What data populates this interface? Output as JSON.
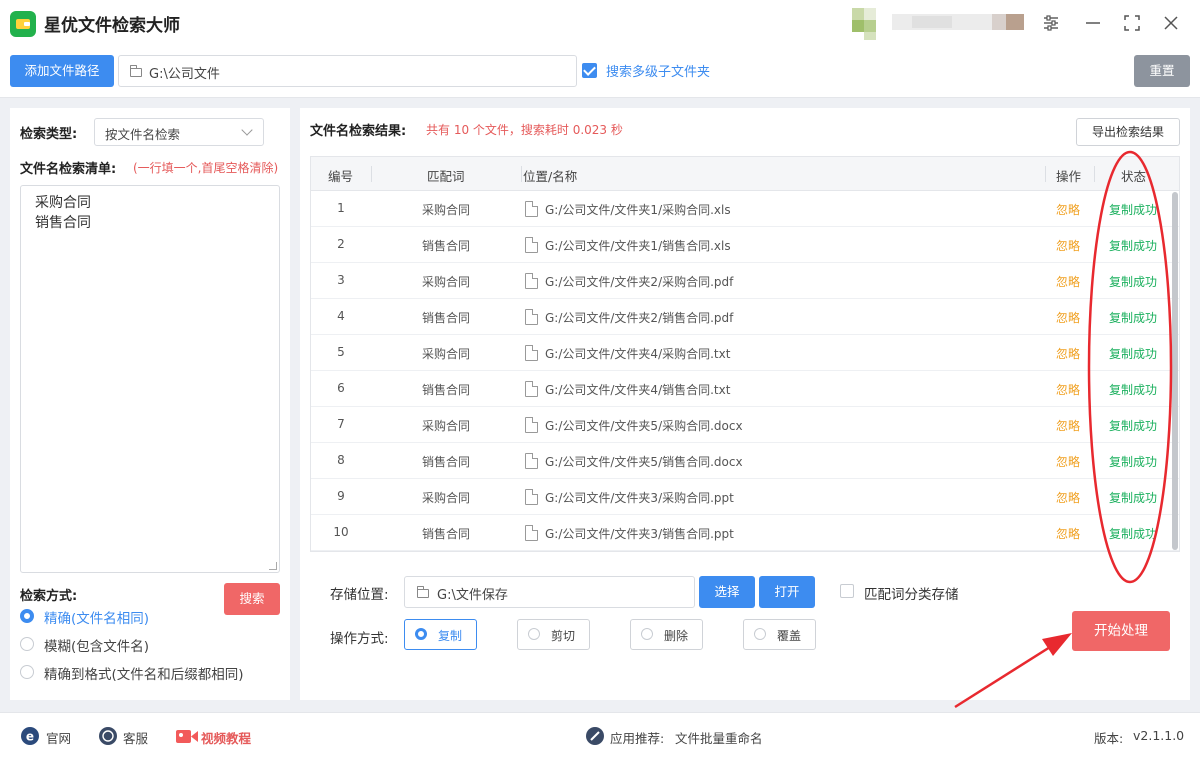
{
  "app": {
    "title": "星优文件检索大师"
  },
  "toolbar": {
    "add_path_label": "添加文件路径",
    "path_value": "G:\\公司文件",
    "subfolder_checkbox_label": "搜索多级子文件夹",
    "subfolder_checked": true,
    "reset_label": "重置"
  },
  "left": {
    "search_type_label": "检索类型:",
    "search_type_value": "按文件名检索",
    "list_label": "文件名检索清单:",
    "list_hint": "(一行填一个,首尾空格清除)",
    "keywords": [
      "采购合同",
      "销售合同"
    ],
    "search_button": "搜索",
    "method_label": "检索方式:",
    "methods": [
      {
        "label": "精确(文件名相同)",
        "selected": true
      },
      {
        "label": "模糊(包含文件名)",
        "selected": false
      },
      {
        "label": "精确到格式(文件名和后缀都相同)",
        "selected": false
      }
    ]
  },
  "results": {
    "title": "文件名检索结果:",
    "summary": "共有 10 个文件，搜索耗时 0.023 秒",
    "export_label": "导出检索结果",
    "columns": {
      "num": "编号",
      "keyword": "匹配词",
      "path": "位置/名称",
      "op": "操作",
      "status": "状态"
    },
    "rows": [
      {
        "num": "1",
        "keyword": "采购合同",
        "path": "G:/公司文件/文件夹1/采购合同.xls",
        "op": "忽略",
        "status": "复制成功"
      },
      {
        "num": "2",
        "keyword": "销售合同",
        "path": "G:/公司文件/文件夹1/销售合同.xls",
        "op": "忽略",
        "status": "复制成功"
      },
      {
        "num": "3",
        "keyword": "采购合同",
        "path": "G:/公司文件/文件夹2/采购合同.pdf",
        "op": "忽略",
        "status": "复制成功"
      },
      {
        "num": "4",
        "keyword": "销售合同",
        "path": "G:/公司文件/文件夹2/销售合同.pdf",
        "op": "忽略",
        "status": "复制成功"
      },
      {
        "num": "5",
        "keyword": "采购合同",
        "path": "G:/公司文件/文件夹4/采购合同.txt",
        "op": "忽略",
        "status": "复制成功"
      },
      {
        "num": "6",
        "keyword": "销售合同",
        "path": "G:/公司文件/文件夹4/销售合同.txt",
        "op": "忽略",
        "status": "复制成功"
      },
      {
        "num": "7",
        "keyword": "采购合同",
        "path": "G:/公司文件/文件夹5/采购合同.docx",
        "op": "忽略",
        "status": "复制成功"
      },
      {
        "num": "8",
        "keyword": "销售合同",
        "path": "G:/公司文件/文件夹5/销售合同.docx",
        "op": "忽略",
        "status": "复制成功"
      },
      {
        "num": "9",
        "keyword": "采购合同",
        "path": "G:/公司文件/文件夹3/采购合同.ppt",
        "op": "忽略",
        "status": "复制成功"
      },
      {
        "num": "10",
        "keyword": "销售合同",
        "path": "G:/公司文件/文件夹3/销售合同.ppt",
        "op": "忽略",
        "status": "复制成功"
      }
    ]
  },
  "storage": {
    "label": "存储位置:",
    "path": "G:\\文件保存",
    "choose_label": "选择",
    "open_label": "打开",
    "classify_label": "匹配词分类存储",
    "classify_checked": false
  },
  "operation": {
    "label": "操作方式:",
    "options": [
      {
        "label": "复制",
        "selected": true
      },
      {
        "label": "剪切",
        "selected": false
      },
      {
        "label": "删除",
        "selected": false
      },
      {
        "label": "覆盖",
        "selected": false
      }
    ],
    "start_label": "开始处理"
  },
  "footer": {
    "website": "官网",
    "service": "客服",
    "video": "视频教程",
    "recommend_label": "应用推荐:",
    "recommend_app": "文件批量重命名",
    "version_label": "版本:",
    "version": "v2.1.1.0"
  },
  "colors": {
    "accent": "#3d8cf0",
    "danger": "#f06767",
    "success": "#1bb05e",
    "warning": "#f0a020",
    "annotation": "#e8292f"
  },
  "icons": [
    "app-logo",
    "settings-sliders-icon",
    "minimize-icon",
    "maximize-icon",
    "close-icon",
    "folder-icon",
    "chevron-down-icon",
    "file-icon",
    "ie-icon",
    "chat-icon",
    "video-icon",
    "link-icon"
  ]
}
